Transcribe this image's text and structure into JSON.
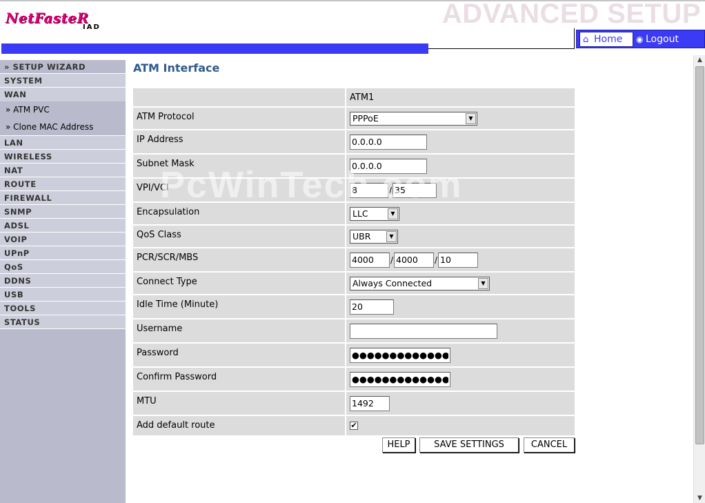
{
  "header": {
    "logo_main": "NetFasteR",
    "logo_sub": "IAD",
    "banner_title": "ADVANCED SETUP",
    "home_label": "Home",
    "logout_label": "Logout",
    "accent_color": "#3b3bf5"
  },
  "sidebar": {
    "items": [
      {
        "label": "» SETUP WIZARD"
      },
      {
        "label": "SYSTEM"
      },
      {
        "label": "WAN"
      },
      {
        "label": "» ATM PVC"
      },
      {
        "label": "» Clone MAC Address"
      },
      {
        "label": "LAN"
      },
      {
        "label": "WIRELESS"
      },
      {
        "label": "NAT"
      },
      {
        "label": "ROUTE"
      },
      {
        "label": "FIREWALL"
      },
      {
        "label": "SNMP"
      },
      {
        "label": "ADSL"
      },
      {
        "label": "VOIP"
      },
      {
        "label": "UPnP"
      },
      {
        "label": "QoS"
      },
      {
        "label": "DDNS"
      },
      {
        "label": "USB"
      },
      {
        "label": "TOOLS"
      },
      {
        "label": "STATUS"
      }
    ]
  },
  "main": {
    "title": "ATM Interface",
    "column_header": "ATM1",
    "fields": {
      "atm_protocol": {
        "label": "ATM Protocol",
        "value": "PPPoE"
      },
      "ip_address": {
        "label": "IP Address",
        "value": "0.0.0.0"
      },
      "subnet_mask": {
        "label": "Subnet Mask",
        "value": "0.0.0.0"
      },
      "vpi_vci": {
        "label": "VPI/VCI",
        "vpi": "8",
        "vci": "35"
      },
      "encapsulation": {
        "label": "Encapsulation",
        "value": "LLC"
      },
      "qos_class": {
        "label": "QoS Class",
        "value": "UBR"
      },
      "pcr_scr_mbs": {
        "label": "PCR/SCR/MBS",
        "pcr": "4000",
        "scr": "4000",
        "mbs": "10"
      },
      "connect_type": {
        "label": "Connect Type",
        "value": "Always Connected"
      },
      "idle_time": {
        "label": "Idle Time (Minute)",
        "value": "20"
      },
      "username": {
        "label": "Username",
        "value": ""
      },
      "password": {
        "label": "Password",
        "value": "●●●●●●●●●●●●●●●●"
      },
      "confirm_password": {
        "label": "Confirm Password",
        "value": "●●●●●●●●●●●●●●●●"
      },
      "mtu": {
        "label": "MTU",
        "value": "1492"
      },
      "default_route": {
        "label": "Add default route",
        "checked": true,
        "mark": "✔"
      }
    },
    "buttons": {
      "help": "HELP",
      "save": "SAVE SETTINGS",
      "cancel": "CANCEL"
    }
  },
  "watermark": "PcWinTech.com"
}
